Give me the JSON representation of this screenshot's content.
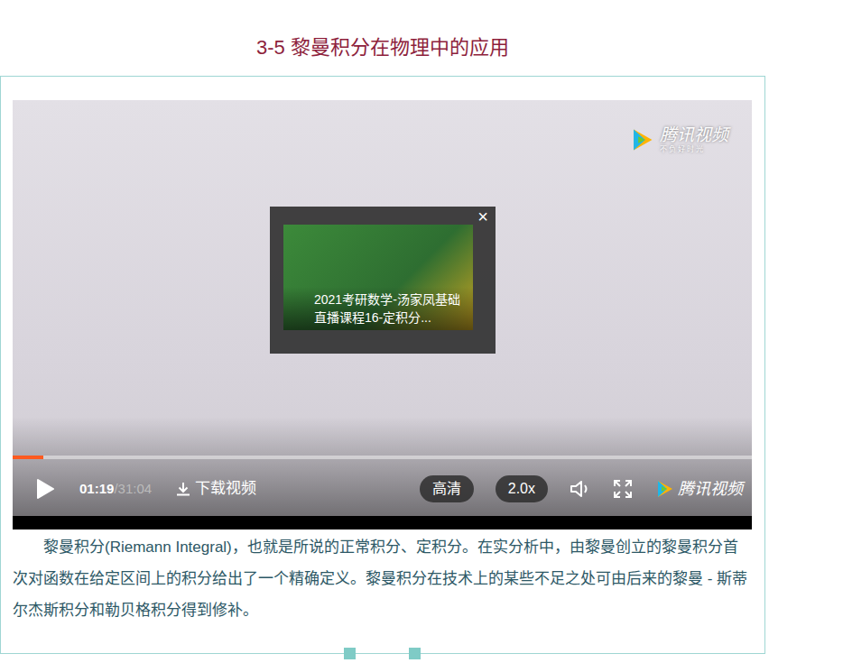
{
  "page": {
    "title": "3-5 黎曼积分在物理中的应用"
  },
  "player": {
    "watermark": "腾讯视频",
    "watermark_sub": "不负好时光",
    "popup": {
      "caption": "2021考研数学-汤家凤基础直播课程16-定积分...",
      "close": "×"
    },
    "controls": {
      "playing": false,
      "current_time": "01:19",
      "duration": "/31:04",
      "download": "下载视频",
      "quality": "高清",
      "speed": "2.0x",
      "logo": "腾讯视频",
      "progress": 0.042
    }
  },
  "description": "黎曼积分(Riemann Integral)，也就是所说的正常积分、定积分。在实分析中，由黎曼创立的黎曼积分首 次对函数在给定区间上的积分给出了一个精确定义。黎曼积分在技术上的某些不足之处可由后来的黎曼 - 斯蒂尔杰斯积分和勒贝格积分得到修补。"
}
